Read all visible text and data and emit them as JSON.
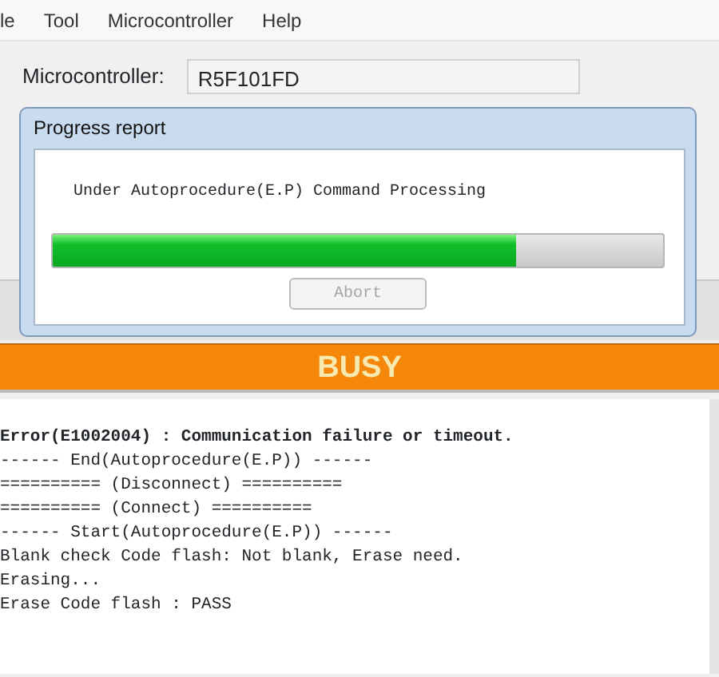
{
  "menu": [
    "le",
    "Tool",
    "Microcontroller",
    "Help"
  ],
  "microcontroller": {
    "label": "Microcontroller:",
    "value": "R5F101FD"
  },
  "dialog": {
    "title": "Progress report",
    "message": "Under Autoprocedure(E.P) Command Processing",
    "progress": {
      "level": 0.76
    },
    "button": {
      "label": "Abort",
      "disabled": true
    }
  },
  "status": {
    "text": "BUSY"
  },
  "log": [
    {
      "text": "Error(E1002004) : Communication failure or timeout.",
      "kind": "error"
    },
    {
      "text": "------ End(Autoprocedure(E.P)) ------",
      "kind": "info"
    },
    {
      "text": "========== (Disconnect) ==========",
      "kind": "info"
    },
    {
      "text": "========== (Connect) ==========",
      "kind": "info"
    },
    {
      "text": "------ Start(Autoprocedure(E.P)) ------",
      "kind": "info"
    },
    {
      "text": "Blank check Code flash: Not blank, Erase need.",
      "kind": "info"
    },
    {
      "text": "Erasing...",
      "kind": "info"
    },
    {
      "text": "Erase Code flash : PASS",
      "kind": "info"
    }
  ]
}
